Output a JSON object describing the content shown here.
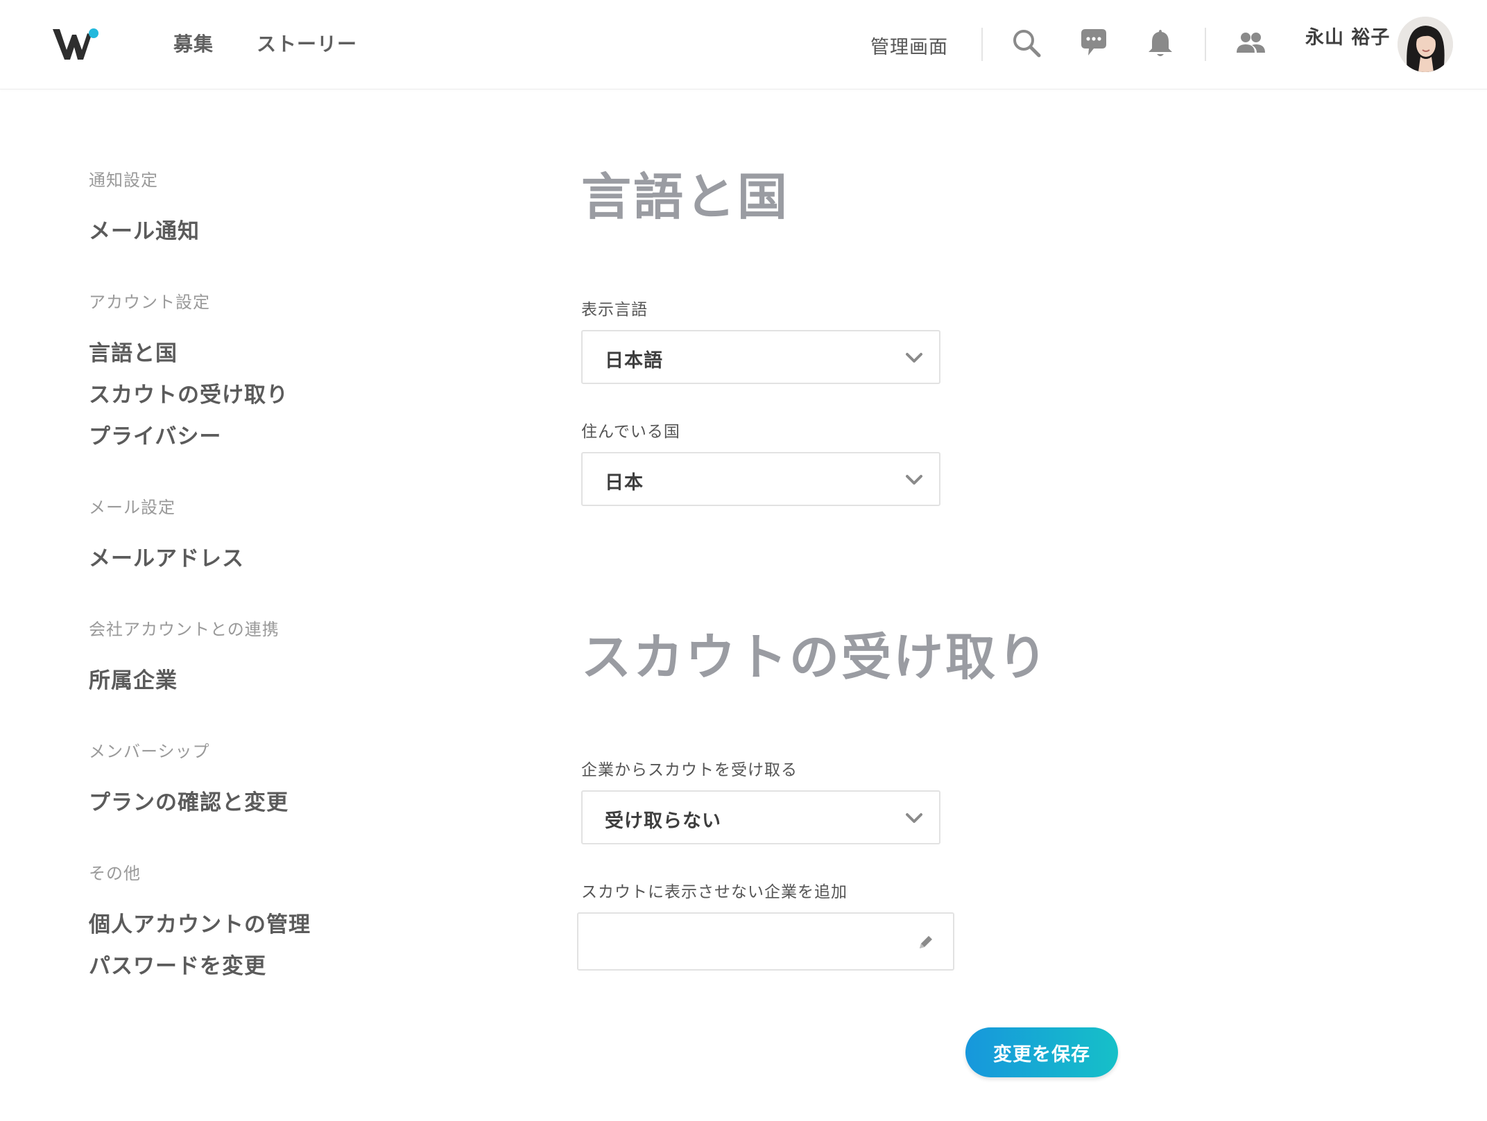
{
  "header": {
    "nav": [
      "募集",
      "ストーリー"
    ],
    "admin_label": "管理画面",
    "icons": [
      "search-icon",
      "chat-icon",
      "bell-icon",
      "people-icon"
    ],
    "user_name": "永山 裕子"
  },
  "colors": {
    "accent_start": "#1797dc",
    "accent_end": "#16c0c8",
    "logo_dot": "#22b8dc",
    "section_title": "#9a9ca2"
  },
  "sidebar": {
    "groups": [
      {
        "heading": "通知設定",
        "items": [
          "メール通知"
        ]
      },
      {
        "heading": "アカウント設定",
        "items": [
          "言語と国",
          "スカウトの受け取り",
          "プライバシー"
        ]
      },
      {
        "heading": "メール設定",
        "items": [
          "メールアドレス"
        ]
      },
      {
        "heading": "会社アカウントとの連携",
        "items": [
          "所属企業"
        ]
      },
      {
        "heading": "メンバーシップ",
        "items": [
          "プランの確認と変更"
        ]
      },
      {
        "heading": "その他",
        "items": [
          "個人アカウントの管理",
          "パスワードを変更"
        ]
      }
    ]
  },
  "main": {
    "language_section": {
      "title": "言語と国",
      "display_language_label": "表示言語",
      "display_language_value": "日本語",
      "country_label": "住んでいる国",
      "country_value": "日本"
    },
    "scout_section": {
      "title": "スカウトの受け取り",
      "receive_label": "企業からスカウトを受け取る",
      "receive_value": "受け取らない",
      "exclude_label": "スカウトに表示させない企業を追加",
      "exclude_value": ""
    },
    "save_label": "変更を保存"
  }
}
